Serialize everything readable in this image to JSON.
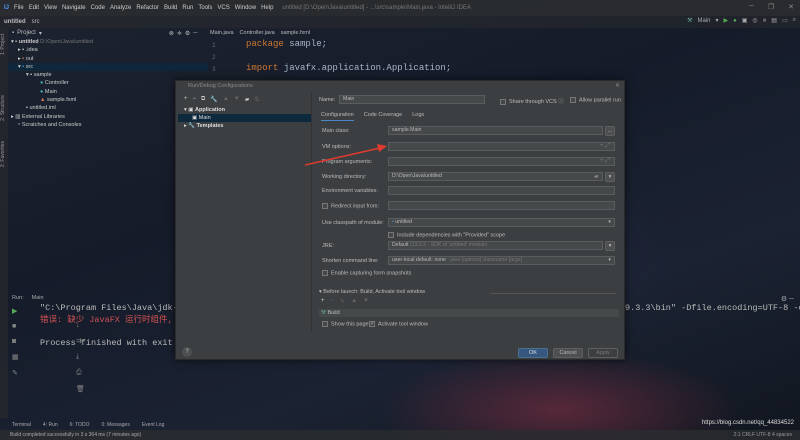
{
  "menu": {
    "items": [
      "File",
      "Edit",
      "View",
      "Navigate",
      "Code",
      "Analyze",
      "Refactor",
      "Build",
      "Run",
      "Tools",
      "VCS",
      "Window",
      "Help"
    ],
    "title": "untitled [D:\\Open\\Java\\untitled] - ...\\src\\sample\\Main.java - IntelliJ IDEA"
  },
  "breadcrumb": [
    "untitled",
    "src"
  ],
  "toolbar": {
    "run_config": "Main"
  },
  "left_strip": [
    "1: Project",
    "2: Structure",
    "2: Favorites"
  ],
  "project": {
    "header": "Project",
    "tree": [
      {
        "label": "untitled",
        "hint": "D:\\Open\\Java\\untitled"
      },
      {
        "label": ".idea"
      },
      {
        "label": "out"
      },
      {
        "label": "src"
      },
      {
        "label": "sample"
      },
      {
        "label": "Controller"
      },
      {
        "label": "Main"
      },
      {
        "label": "sample.fxml"
      },
      {
        "label": "untitled.iml"
      },
      {
        "label": "External Libraries"
      },
      {
        "label": "Scratches and Consoles"
      }
    ]
  },
  "editor": {
    "tabs": [
      "Main.java",
      "Controller.java",
      "sample.fxml"
    ],
    "line_numbers": [
      "1",
      "2",
      "3"
    ],
    "code": {
      "l1_kw": "package",
      "l1_rest": " sample;",
      "l3_kw": "import",
      "l3_rest": " javafx.application.Application;"
    }
  },
  "dialog": {
    "title": "Run/Debug Configurations",
    "tree": {
      "application": "Application",
      "main": "Main",
      "templates": "Templates"
    },
    "name_label": "Name:",
    "name_value": "Main",
    "share_vcs": "Share through VCS",
    "allow_parallel": "Allow parallel run",
    "tabs": [
      "Configuration",
      "Code Coverage",
      "Logs"
    ],
    "fields": {
      "main_class_label": "Main class:",
      "main_class_value": "sample.Main",
      "vm_label": "VM options:",
      "vm_value": "",
      "args_label": "Program arguments:",
      "workdir_label": "Working directory:",
      "workdir_value": "D:\\Open\\Java\\untitled",
      "env_label": "Environment variables:",
      "redirect_label": "Redirect input from:",
      "classpath_label": "Use classpath of module:",
      "classpath_value": "untitled",
      "include_deps": "Include dependencies with \"Provided\" scope",
      "jre_label": "JRE:",
      "jre_value": "Default",
      "jre_hint": "(13.0.2 - SDK of 'untitled' module)",
      "shorten_label": "Shorten command line:",
      "shorten_value": "user-local default: none",
      "shorten_hint": "- java [options] classname [args]",
      "snapshots": "Enable capturing form snapshots"
    },
    "before_launch": "Before launch: Build, Activate tool window",
    "build_item": "Build",
    "show_page": "Show this page",
    "activate_tool": "Activate tool window",
    "buttons": {
      "ok": "OK",
      "cancel": "Cancel",
      "apply": "Apply",
      "help": "?"
    }
  },
  "run": {
    "label": "Run:",
    "tab": "Main",
    "lines": {
      "cmd": "\"C:\\Program Files\\Java\\jdk-13.",
      "cmd_tail": "9.3.3\\bin\" -Dfile.encoding=UTF-8 -cl",
      "err": "错误: 缺少 JavaFX 运行时组件, 需",
      "exit": "Process finished with exit cod"
    }
  },
  "bottom_tabs": [
    "Terminal",
    "4: Run",
    "6: TODO",
    "0: Messages",
    "Event Log"
  ],
  "status": {
    "text": "Build completed successfully in 3 s 364 ms (7 minutes ago)",
    "right": "2:1  CRLF  UTF-8  4 spaces"
  },
  "watermark": "https://blog.csdn.net/qq_44834522"
}
